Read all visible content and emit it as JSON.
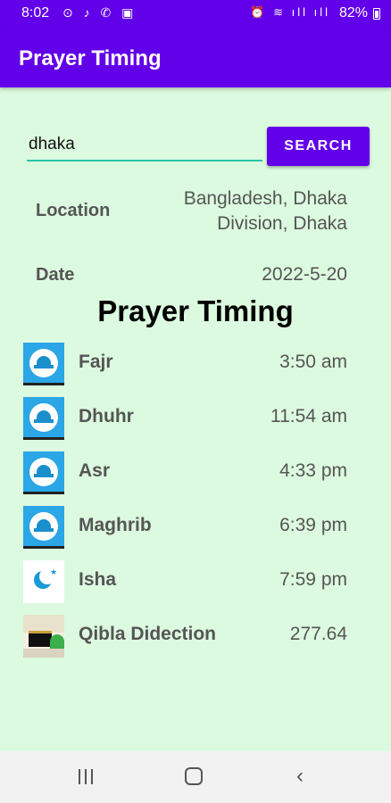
{
  "status_bar": {
    "time": "8:02",
    "left_icons": "⊙ ♪ ✆ ▣",
    "right_icons": "⏰ ≋ ıll ıll",
    "battery": "82%"
  },
  "app_bar": {
    "title": "Prayer Timing"
  },
  "search": {
    "value": "dhaka",
    "button_label": "SEARCH"
  },
  "location": {
    "label": "Location",
    "value_line1": "Bangladesh, Dhaka",
    "value_line2": "Division, Dhaka"
  },
  "date": {
    "label": "Date",
    "value": "2022-5-20"
  },
  "section_title": "Prayer Timing",
  "prayers": [
    {
      "name": "Fajr",
      "time": "3:50 am",
      "icon": "mosque-icon"
    },
    {
      "name": "Dhuhr",
      "time": "11:54 am",
      "icon": "mosque-icon"
    },
    {
      "name": "Asr",
      "time": "4:33 pm",
      "icon": "mosque-icon"
    },
    {
      "name": "Maghrib",
      "time": "6:39 pm",
      "icon": "mosque-icon"
    },
    {
      "name": "Isha",
      "time": "7:59 pm",
      "icon": "moon-icon"
    },
    {
      "name": "Qibla Didection",
      "time": "277.64",
      "icon": "kaaba-icon"
    }
  ],
  "colors": {
    "primary": "#6200ea",
    "background": "#dcfadf",
    "accent_line": "#26c6a8",
    "icon_blue": "#2ba6e6"
  }
}
